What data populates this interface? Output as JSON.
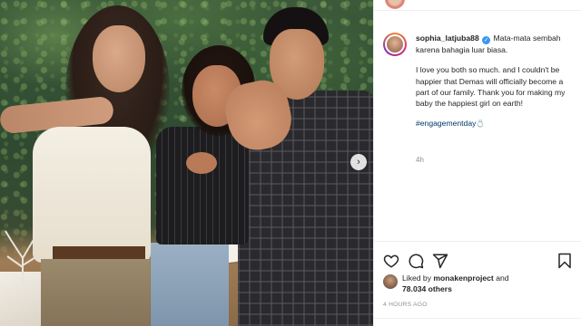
{
  "post": {
    "username": "sophia_latjuba88",
    "verified": true,
    "caption_line1": "Mata-mata sembah karena bahagia luar biasa.",
    "caption_line2": "I love you both so much. and I couldn't be happier that Demas will officially become a part of our family. Thank you for making my baby the happiest girl on earth!",
    "hashtag": "#engagementday",
    "hashtag_emoji": "💍",
    "time_ago": "4h"
  },
  "likes": {
    "prefix": "Liked by",
    "user": "monakenproject",
    "conj": "and",
    "count": "78.034 others"
  },
  "timestamp": "4 HOURS AGO",
  "icons": {
    "heart": "heart-icon",
    "comment": "comment-icon",
    "share": "send-icon",
    "save": "bookmark-icon",
    "next": "chevron-right-icon"
  },
  "colors": {
    "verified": "#3897f0",
    "hashtag": "#00376b",
    "muted": "#8e8e8e"
  }
}
